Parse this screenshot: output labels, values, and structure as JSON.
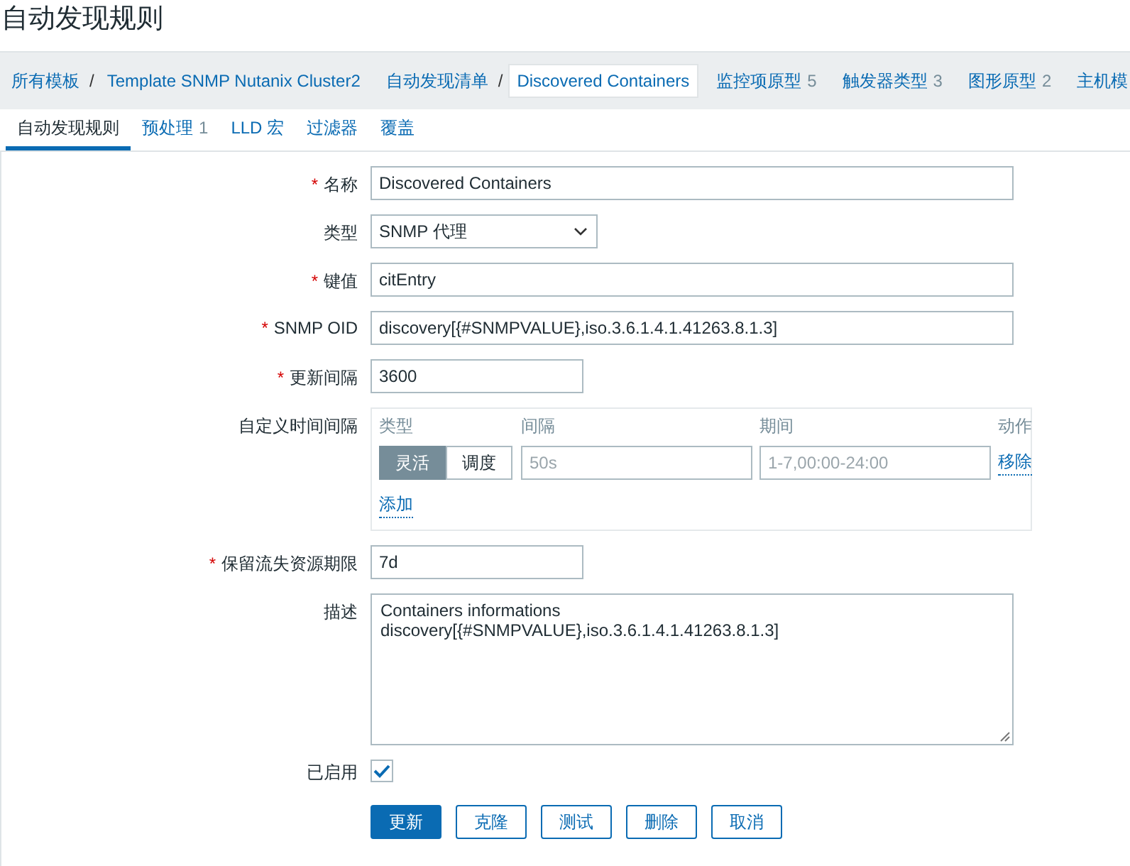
{
  "page_title": "自动发现规则",
  "breadcrumb": [
    {
      "label": "所有模板",
      "separator": "/",
      "selected": false
    },
    {
      "label": "Template SNMP Nutanix Cluster2",
      "selected": false
    },
    {
      "label": "自动发现清单",
      "separator": "/",
      "selected": false
    },
    {
      "label": "Discovered Containers",
      "selected": true
    },
    {
      "label": "监控项原型",
      "count": "5",
      "selected": false
    },
    {
      "label": "触发器类型",
      "count": "3",
      "selected": false
    },
    {
      "label": "图形原型",
      "count": "2",
      "selected": false
    },
    {
      "label": "主机模",
      "selected": false
    }
  ],
  "tabs": [
    {
      "label": "自动发现规则",
      "selected": true
    },
    {
      "label": "预处理",
      "count": "1",
      "selected": false
    },
    {
      "label": "LLD 宏",
      "selected": false
    },
    {
      "label": "过滤器",
      "selected": false
    },
    {
      "label": "覆盖",
      "selected": false
    }
  ],
  "form": [
    {
      "kind": "text",
      "label": "名称",
      "required_mark": "*",
      "value": "Discovered Containers"
    },
    {
      "kind": "select",
      "label": "类型",
      "value": "SNMP 代理"
    },
    {
      "kind": "text",
      "label": "键值",
      "required_mark": "*",
      "value": "citEntry"
    },
    {
      "kind": "text",
      "label": "SNMP OID",
      "required_mark": "*",
      "value": "discovery[{#SNMPVALUE},iso.3.6.1.4.1.41263.8.1.3]"
    },
    {
      "kind": "short_text",
      "label": "更新间隔",
      "required_mark": "*",
      "value": "3600"
    },
    {
      "kind": "intervals",
      "label": "自定义时间间隔",
      "columns": [
        "类型",
        "间隔",
        "期间",
        "动作"
      ],
      "rows": [
        {
          "modes": [
            {
              "label": "灵活",
              "selected": true
            },
            {
              "label": "调度",
              "selected": false
            }
          ],
          "interval_placeholder": "50s",
          "period_placeholder": "1-7,00:00-24:00",
          "remove": "移除"
        }
      ],
      "add": "添加"
    },
    {
      "kind": "short_text",
      "label": "保留流失资源期限",
      "required_mark": "*",
      "value": "7d"
    },
    {
      "kind": "textarea",
      "label": "描述",
      "value": "Containers informations\ndiscovery[{#SNMPVALUE},iso.3.6.1.4.1.41263.8.1.3]"
    },
    {
      "kind": "checkbox",
      "label": "已启用",
      "checked": true
    }
  ],
  "buttons": [
    {
      "label": "更新",
      "kind": "primary"
    },
    {
      "label": "克隆",
      "kind": "secondary"
    },
    {
      "label": "测试",
      "kind": "secondary"
    },
    {
      "label": "删除",
      "kind": "secondary"
    },
    {
      "label": "取消",
      "kind": "secondary"
    }
  ]
}
